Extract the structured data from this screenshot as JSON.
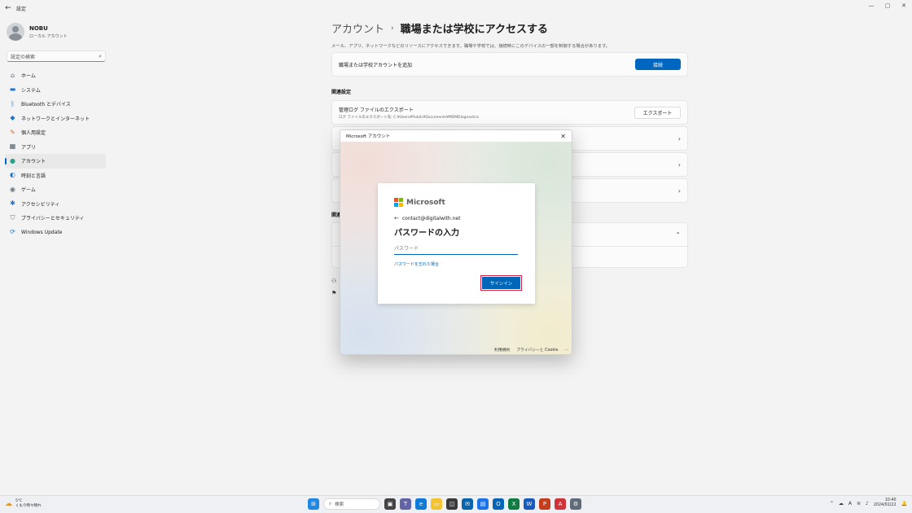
{
  "window": {
    "title": "設定",
    "back": "←",
    "controls": [
      "—",
      "▢",
      "✕"
    ]
  },
  "user": {
    "name": "NOBU",
    "type": "ローカル アカウント"
  },
  "search": {
    "placeholder": "設定の検索"
  },
  "nav": [
    {
      "label": "ホーム",
      "icon": "home-icon",
      "glyph": "⌂",
      "color": "#5b6b7a"
    },
    {
      "label": "システム",
      "icon": "monitor-icon",
      "glyph": "▬",
      "color": "#1d75c7"
    },
    {
      "label": "Bluetooth とデバイス",
      "icon": "bluetooth-icon",
      "glyph": "ᛒ",
      "color": "#1d75c7"
    },
    {
      "label": "ネットワークとインターネット",
      "icon": "wifi-icon",
      "glyph": "◆",
      "color": "#1d75c7"
    },
    {
      "label": "個人用設定",
      "icon": "brush-icon",
      "glyph": "✎",
      "color": "#c9773a"
    },
    {
      "label": "アプリ",
      "icon": "apps-icon",
      "glyph": "▦",
      "color": "#4f5c6b"
    },
    {
      "label": "アカウント",
      "icon": "person-icon",
      "glyph": "●",
      "color": "#2aa38b",
      "active": true
    },
    {
      "label": "時刻と言語",
      "icon": "globe-icon",
      "glyph": "◐",
      "color": "#1d75c7"
    },
    {
      "label": "ゲーム",
      "icon": "gamepad-icon",
      "glyph": "◉",
      "color": "#6b7580"
    },
    {
      "label": "アクセシビリティ",
      "icon": "accessibility-icon",
      "glyph": "✱",
      "color": "#1d75c7"
    },
    {
      "label": "プライバシーとセキュリティ",
      "icon": "shield-icon",
      "glyph": "⛉",
      "color": "#6b7580"
    },
    {
      "label": "Windows Update",
      "icon": "update-icon",
      "glyph": "⟳",
      "color": "#1d75c7"
    }
  ],
  "main": {
    "crumb_parent": "アカウント",
    "crumb_sep": "›",
    "crumb_current": "職場または学校にアクセスする",
    "description": "メール、アプリ、ネットワークなどのリソースにアクセスできます。職場や学校では、接続時にこのデバイスの一部を制御する場合があります。",
    "add_label": "職場または学校アカウントを追加",
    "connect_button": "接続",
    "related_title": "関連設定",
    "export_title": "管理ログ ファイルのエクスポート",
    "export_sub": "ログ ファイルのエクスポート先: C:¥Users¥Public¥Documents¥MDMDiagnostics",
    "export_button": "エクスポート",
    "related_support": "関連",
    "chevron": "›",
    "chevron_up": "⌃"
  },
  "dialog": {
    "title": "Microsoft アカウント",
    "close": "✕",
    "brand": "Microsoft",
    "back_arrow": "←",
    "email": "contact@digitalwith.net",
    "heading": "パスワードの入力",
    "password_placeholder": "パスワード",
    "forgot": "パスワードを忘れた場合",
    "signin_button": "サインイン",
    "footer_terms": "利用規約",
    "footer_privacy": "プライバシーと Cookie",
    "footer_more": "..."
  },
  "taskbar": {
    "temp": "5°C",
    "weather": "くもり時々晴れ",
    "search_label": "検索",
    "time": "10:40",
    "date": "2024/02/22"
  }
}
